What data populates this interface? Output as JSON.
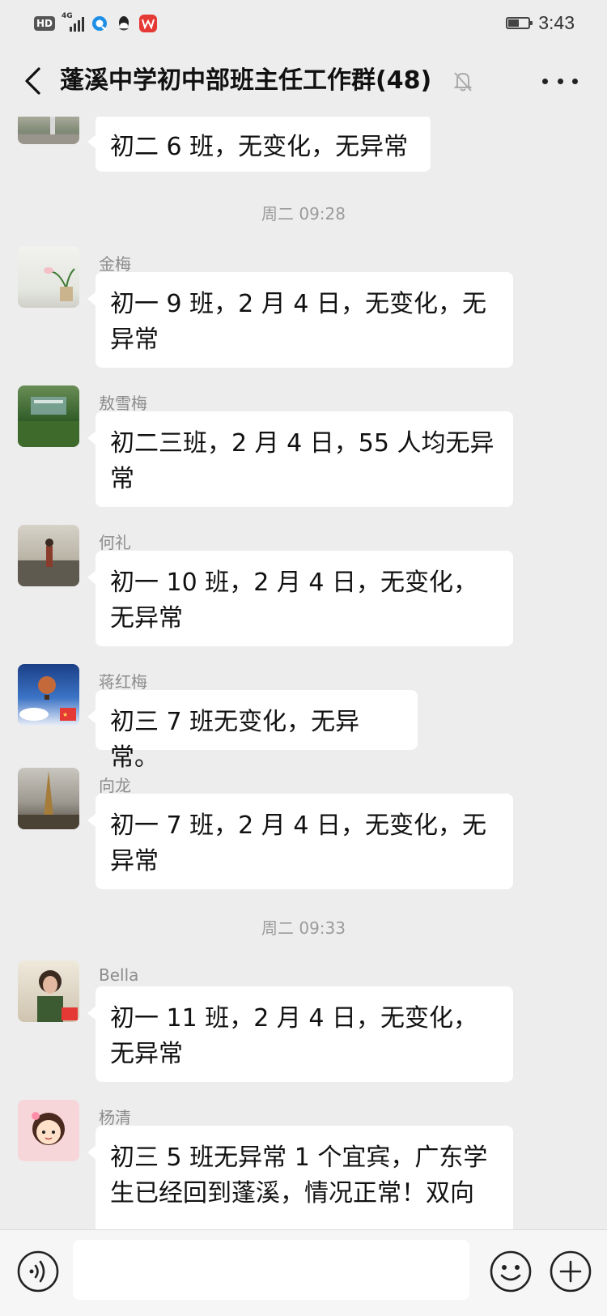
{
  "status_bar": {
    "hd_badge": "HD",
    "network": "4G",
    "time": "3:43",
    "battery_level": 0.55
  },
  "header": {
    "title": "蓬溪中学初中部班主任工作群(48)",
    "back_icon": "chevron-left-icon",
    "mute_icon": "bell-off-icon",
    "more_icon": "more-horizontal-icon"
  },
  "messages": [
    {
      "type": "message",
      "sender": "",
      "text": "初二 6 班，无变化，无异常",
      "avatar": "photo-avatar"
    },
    {
      "type": "timestamp",
      "text": "周二 09:28"
    },
    {
      "type": "message",
      "sender": "金梅",
      "text": "初一 9 班，2 月 4 日，无变化，无异常",
      "avatar": "flower-avatar"
    },
    {
      "type": "message",
      "sender": "敖雪梅",
      "text": "初二三班，2 月 4 日，55 人均无异常",
      "avatar": "sign-avatar"
    },
    {
      "type": "message",
      "sender": "何礼",
      "text": "初一 10 班，2 月 4 日，无变化，无异常",
      "avatar": "person-avatar"
    },
    {
      "type": "message",
      "sender": "蒋红梅",
      "text": "初三 7 班无变化，无异常。",
      "avatar": "balloon-avatar"
    },
    {
      "type": "message",
      "sender": "向龙",
      "text": "初一 7 班，2 月 4 日，无变化，无异常",
      "avatar": "tower-avatar"
    },
    {
      "type": "timestamp",
      "text": "周二 09:33"
    },
    {
      "type": "message",
      "sender": "Bella",
      "text": "初一 11 班，2 月 4 日，无变化，无异常",
      "avatar": "girl-avatar"
    },
    {
      "type": "message",
      "sender": "杨清",
      "text": "初三 5 班无异常 1 个宜宾，广东学生已经回到蓬溪，情况正常！双向",
      "avatar": "cartoon-avatar"
    }
  ],
  "input_bar": {
    "voice_icon": "voice-icon",
    "input_value": "",
    "emoji_icon": "emoji-icon",
    "plus_icon": "plus-icon"
  },
  "colors": {
    "background": "#ededed",
    "bubble": "#ffffff",
    "footer": "#f6f6f6",
    "timestamp": "#9b9b9b"
  }
}
